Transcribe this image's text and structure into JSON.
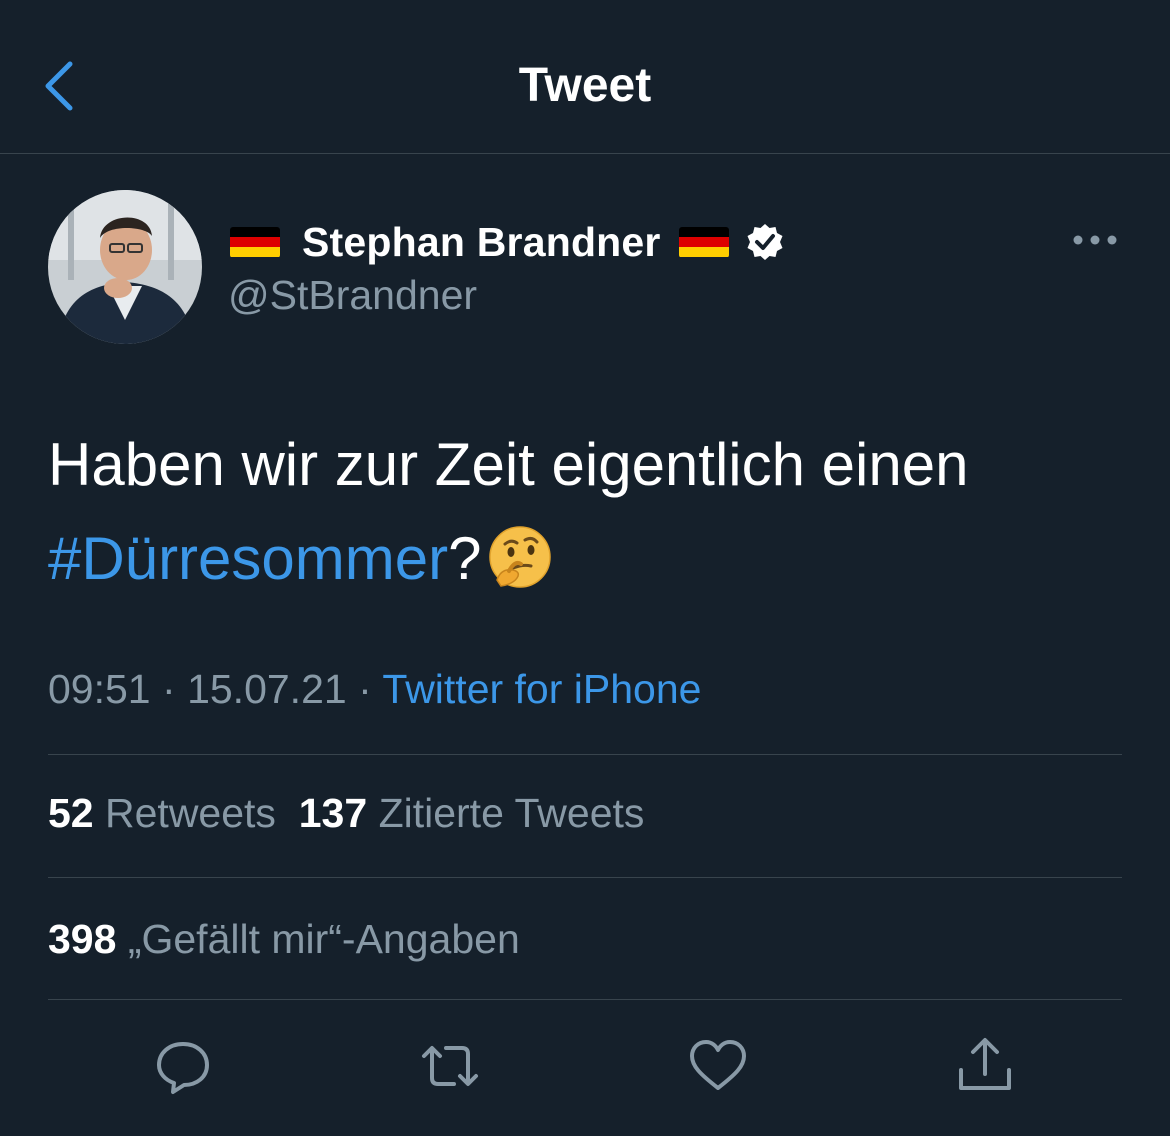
{
  "header": {
    "title": "Tweet",
    "back_icon": "chevron-left-icon"
  },
  "author": {
    "display_name": "Stephan Brandner",
    "handle": "@StBrandner",
    "flag_icon": "german-flag-icon",
    "verified_icon": "verified-badge-icon"
  },
  "tweet": {
    "text_line1": "Haben wir zur Zeit eigentlich einen",
    "hashtag": "#Dürresommer",
    "after_hashtag": "?",
    "emoji": "thinking-face-emoji"
  },
  "meta": {
    "time": "09:51",
    "dot1": "·",
    "date": "15.07.21",
    "dot2": "·",
    "source": "Twitter for iPhone"
  },
  "stats": {
    "retweets_count": "52",
    "retweets_label": "Retweets",
    "quotes_count": "137",
    "quotes_label": "Zitierte Tweets",
    "likes_count": "398",
    "likes_label": "„Gefällt mir“-Angaben"
  },
  "colors": {
    "background": "#15202b",
    "separator": "#38444d",
    "secondary_text": "#8899a6",
    "accent": "#3c97e8"
  },
  "actions": [
    "reply-icon",
    "retweet-icon",
    "like-icon",
    "share-icon"
  ]
}
